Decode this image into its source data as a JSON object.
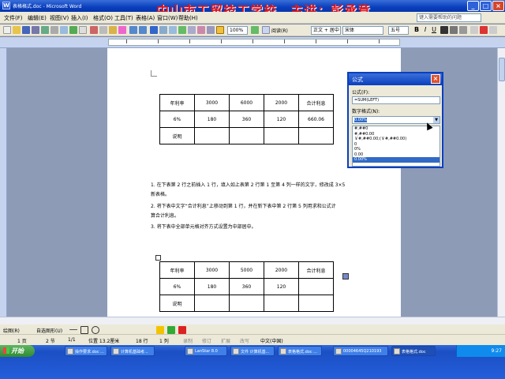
{
  "window": {
    "title": "表格格式.doc - Microsoft Word",
    "banner": "中山市工贸技工学校　主讲：彭承意"
  },
  "menu": [
    "文件(F)",
    "编辑(E)",
    "视图(V)",
    "插入(I)",
    "格式(O)",
    "工具(T)",
    "表格(A)",
    "窗口(W)",
    "帮助(H)"
  ],
  "help_placeholder": "键入需要帮助的问题",
  "toolbar": {
    "zoom": "100%",
    "read_label": "阅读(R)",
    "style": "正文 + 居中",
    "font": "宋体",
    "size": "五号"
  },
  "table1": [
    [
      "年利率",
      "3000",
      "6000",
      "2000",
      "合计利息"
    ],
    [
      "6%",
      "180",
      "360",
      "120",
      "660.06"
    ],
    [
      "说明",
      "",
      "",
      "",
      ""
    ]
  ],
  "instructions": [
    "1. 在下表第 2 行之前插入 1 行，填入如上表第 2 行第 1 至第 4 列一样的文字，修改成 3×5",
    "新表格。",
    "2. 将下表中文字“合计利息”上移动到第 1 行，并在新下表中第 2 行第 5 列用求和公式计",
    "算合计利息。",
    "3. 将下表中全部单元格对齐方式设置为中部居中。"
  ],
  "table2": [
    [
      "年利率",
      "3000",
      "5000",
      "2000",
      "合计利息"
    ],
    [
      "6%",
      "180",
      "360",
      "120",
      ""
    ],
    [
      "说明",
      "",
      "",
      "",
      ""
    ]
  ],
  "dialog": {
    "title": "公式",
    "formula_label": "公式(F):",
    "formula_value": "=SUM(LEFT)",
    "format_label": "数字格式(N):",
    "format_value": "0.00%",
    "format_options": [
      "#,##0",
      "#,##0.00",
      "￥#,##0.00;(￥#,##0.00)",
      "0",
      "0%",
      "0.00",
      "0.00%"
    ]
  },
  "drawbar": {
    "draw": "绘图(R)",
    "autoshapes": "自选图形(U)"
  },
  "status": {
    "page": "1 页",
    "section": "2 节",
    "pages": "1/1",
    "position": "位置 13.2厘米",
    "line": "18 行",
    "col": "1 列",
    "rec": "录制",
    "rev": "修订",
    "ext": "扩展",
    "ovr": "改写",
    "lang": "中文(中国)"
  },
  "taskbar": {
    "start": "开始",
    "tasks": [
      "操作要求.doc ...",
      "计算机基础考...",
      "LanStar 8.0",
      "文件 计算机基...",
      "表格格式.doc ...",
      "00004645Q210193",
      "表格格式.doc"
    ],
    "active_task_index": 6,
    "clock": "9:27"
  },
  "colors": {
    "banner": "#d8131f",
    "titlebar": "#0a3fbf",
    "dialog_selection": "#316ac5"
  },
  "icons": [
    "word-app-icon",
    "minimize-icon",
    "maximize-icon",
    "close-icon",
    "table-move-handle-icon",
    "paragraph-mark-icon"
  ]
}
